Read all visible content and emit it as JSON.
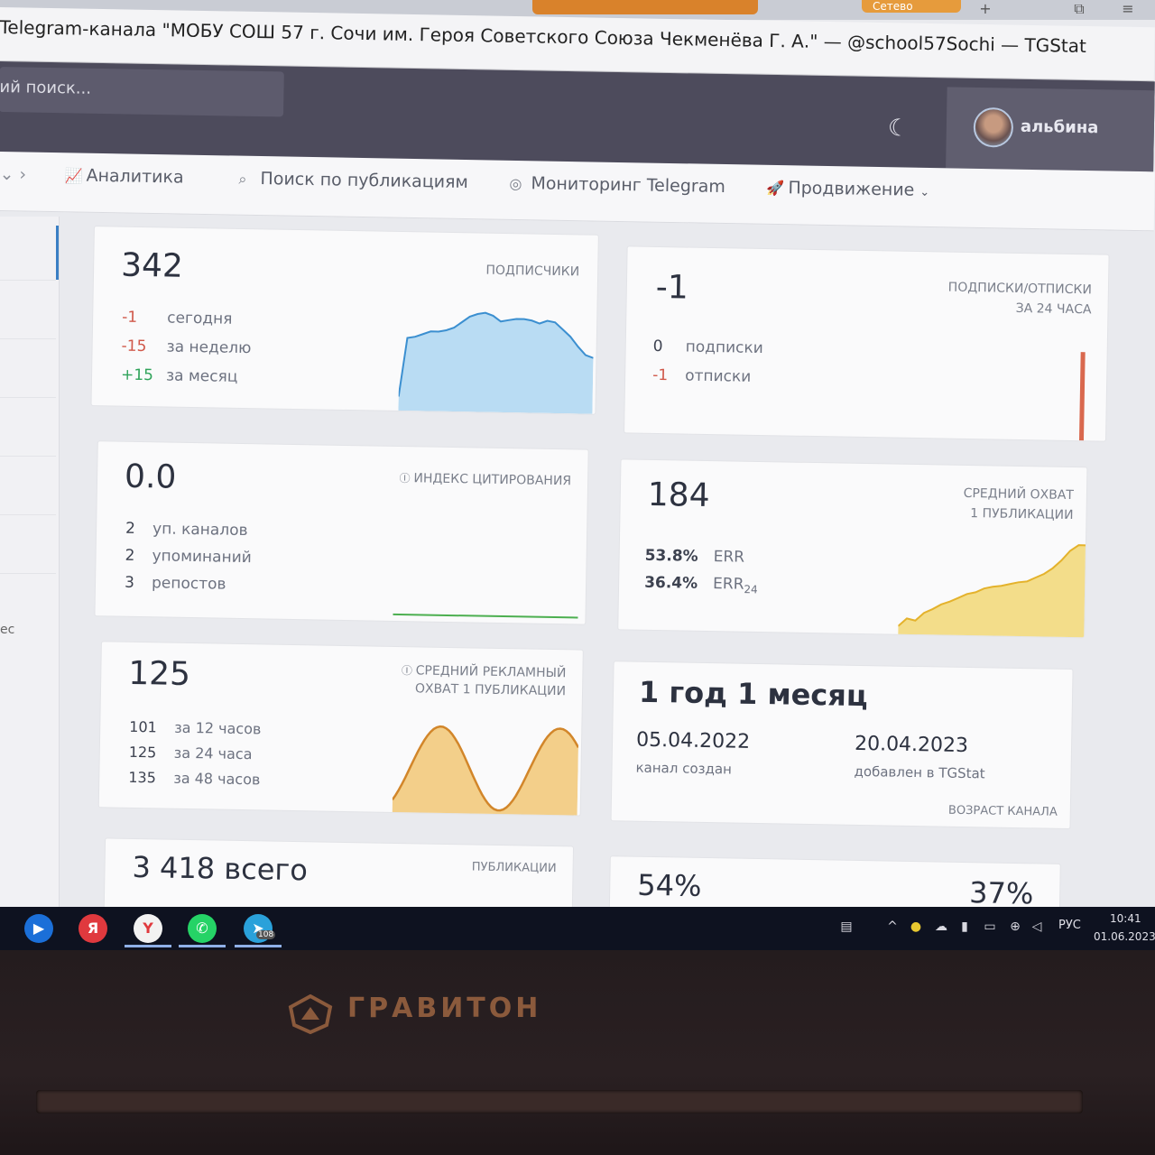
{
  "browser": {
    "tab_label": "Сетево",
    "title": "Telegram-канала \"МОБУ СОШ 57 г. Сочи им. Героя Советского Союза Чекменёва Г. А.\" — @school57Sochi — TGStat"
  },
  "header": {
    "search_placeholder": "ий поиск...",
    "username": "альбина",
    "theme_icon": "moon-icon"
  },
  "nav": {
    "items": [
      {
        "label": "Аналитика",
        "icon": "chart-line-icon"
      },
      {
        "label": "Поиск по публикациям",
        "icon": "search-icon"
      },
      {
        "label": "Мониторинг Telegram",
        "icon": "monitor-icon"
      },
      {
        "label": "Продвижение",
        "icon": "rocket-icon"
      }
    ]
  },
  "sidebar": {
    "partial_text": "ес"
  },
  "cards": {
    "subscribers": {
      "value": "342",
      "title": "ПОДПИСЧИКИ",
      "rows": [
        {
          "value": "-1",
          "label": "сегодня"
        },
        {
          "value": "-15",
          "label": "за неделю"
        },
        {
          "value": "+15",
          "label": "за месяц"
        }
      ],
      "chart": [
        10,
        52,
        53,
        55,
        57,
        57,
        58,
        60,
        64,
        68,
        70,
        71,
        69,
        65,
        66,
        67,
        67,
        66,
        64,
        66,
        65,
        60,
        55,
        48,
        42,
        40
      ]
    },
    "subs_unsubs": {
      "value": "-1",
      "title_line1": "ПОДПИСКИ/ОТПИСКИ",
      "title_line2": "ЗА 24 ЧАСА",
      "rows": [
        {
          "value": "0",
          "label": "подписки"
        },
        {
          "value": "-1",
          "label": "отписки"
        }
      ]
    },
    "citation": {
      "value": "0.0",
      "title": "ИНДЕКС ЦИТИРОВАНИЯ",
      "rows": [
        {
          "value": "2",
          "label": "уп. каналов"
        },
        {
          "value": "2",
          "label": "упоминаний"
        },
        {
          "value": "3",
          "label": "репостов"
        }
      ]
    },
    "reach": {
      "value": "184",
      "title_line1": "СРЕДНИЙ ОХВАТ",
      "title_line2": "1 ПУБЛИКАЦИИ",
      "rows": [
        {
          "value": "53.8%",
          "label": "ERR"
        },
        {
          "value": "36.4%",
          "label": "ERR",
          "sub": "24"
        }
      ],
      "chart": [
        10,
        18,
        16,
        24,
        28,
        33,
        36,
        40,
        44,
        46,
        50,
        52,
        53,
        55,
        57,
        58,
        62,
        66,
        72,
        80,
        90,
        96,
        96
      ]
    },
    "ad_reach": {
      "value": "125",
      "title_line1": "СРЕДНИЙ РЕКЛАМНЫЙ",
      "title_line2": "ОХВАТ 1 ПУБЛИКАЦИИ",
      "rows": [
        {
          "value": "101",
          "label": "за 12 часов"
        },
        {
          "value": "125",
          "label": "за 24 часа"
        },
        {
          "value": "135",
          "label": "за 48 часов"
        }
      ]
    },
    "age": {
      "value": "1 год 1 месяц",
      "created_date": "05.04.2022",
      "created_label": "канал создан",
      "added_date": "20.04.2023",
      "added_label": "добавлен в TGStat",
      "title": "ВОЗРАСТ КАНАЛА"
    },
    "posts": {
      "value": "3 418 всего",
      "title": "ПУБЛИКАЦИИ"
    },
    "percents": {
      "left": "54%",
      "right": "37%"
    }
  },
  "taskbar": {
    "lang": "РУС",
    "time": "10:41",
    "date": "01.06.2023",
    "telegram_badge": "108",
    "apps": [
      "cortana-icon",
      "yandex-icon",
      "yandex-browser-icon",
      "whatsapp-icon",
      "telegram-icon"
    ]
  },
  "laptop": {
    "brand": "ГРАВИТОН"
  },
  "colors": {
    "subscribers_line": "#3b8fd0",
    "subscribers_fill": "#b9dcf3",
    "reach_line": "#e4b22c",
    "reach_fill": "#f3dd8a",
    "ad_line": "#d2862a",
    "ad_fill": "#f3cf8a",
    "unsubs_bar": "#d9684e",
    "citation_line": "#4caf50"
  }
}
